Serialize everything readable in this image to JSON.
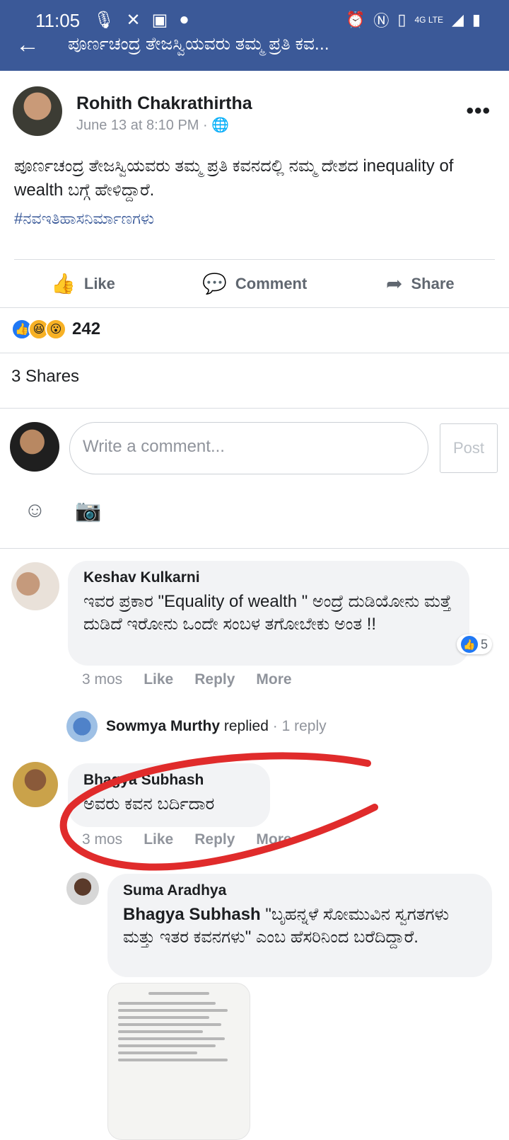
{
  "status_bar": {
    "time": "11:05",
    "network": "4G LTE"
  },
  "header": {
    "title": "ಪೂರ್ಣಚಂದ್ರ ತೇಜಸ್ವಿಯವರು ತಮ್ಮ ಪ್ರತಿ ಕವ..."
  },
  "post": {
    "author": "Rohith Chakrathirtha",
    "time": "June 13 at 8:10 PM · ",
    "text": "ಪೂರ್ಣಚಂದ್ರ ತೇಜಸ್ವಿಯವರು ತಮ್ಮ ಪ್ರತಿ ಕವನದಲ್ಲಿ ನಮ್ಮ ದೇಶದ inequality of wealth ಬಗ್ಗೆ ಹೇಳಿದ್ದಾರೆ.",
    "hashtag": "#ನವಇತಿಹಾಸನಿರ್ಮಾಣಗಳು"
  },
  "actions": {
    "like": "Like",
    "comment": "Comment",
    "share": "Share"
  },
  "reactions": {
    "count": "242"
  },
  "shares": "3 Shares",
  "composer": {
    "placeholder": "Write a comment...",
    "post_label": "Post"
  },
  "comments": [
    {
      "name": "Keshav Kulkarni",
      "text": "ಇವರ ಪ್ರಕಾರ \"Equality of wealth \" ಅಂದ್ರೆ ದುಡಿಯೋನು ಮತ್ತೆ ದುಡಿದೆ ಇರೋನು ಒಂದೇ ಸಂಬಳ ತಗೋಬೇಕು ಅಂತ !!",
      "time": "3 mos",
      "like": "Like",
      "reply": "Reply",
      "more": "More",
      "likes": "5",
      "replied_name": "Sowmya Murthy",
      "replied_word": " replied",
      "replied_count": " · 1 reply"
    },
    {
      "name": "Bhagya Subhash",
      "text": "ಅವರು ಕವನ ಬರ್ದಿದಾರ",
      "time": "3 mos",
      "like": "Like",
      "reply": "Reply",
      "more": "More"
    },
    {
      "name": "Suma Aradhya",
      "tag": "Bhagya Subhash",
      "text": " \"ಬೃಹನ್ನಳೆ ಸೋಮುವಿನ ಸ್ವಗತಗಳು ಮತ್ತು ಇತರ ಕವನಗಳು\" ಎಂಬ ಹೆಸರಿನಿಂದ ಬರೆದಿದ್ದಾರೆ."
    }
  ],
  "colors": {
    "header_bg": "#3b5998",
    "link": "#385898",
    "annotation": "#e02b2b"
  }
}
